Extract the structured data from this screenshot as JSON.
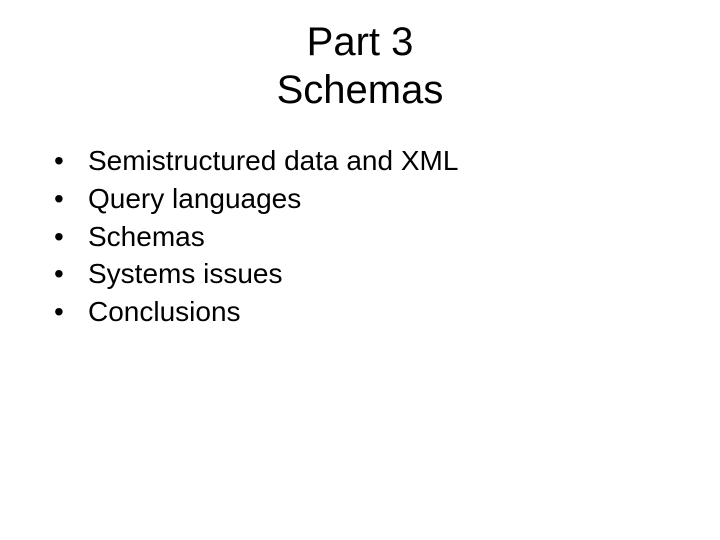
{
  "title": {
    "line1": "Part 3",
    "line2": "Schemas"
  },
  "bullets": [
    "Semistructured data and XML",
    "Query languages",
    "Schemas",
    "Systems issues",
    "Conclusions"
  ]
}
